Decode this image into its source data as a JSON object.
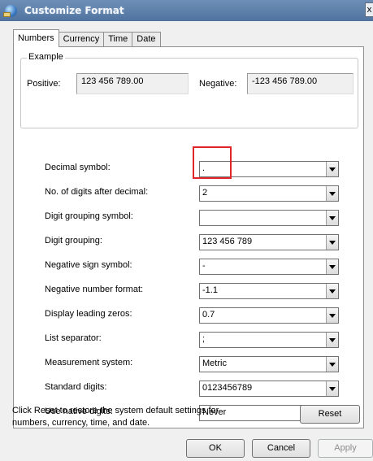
{
  "window": {
    "title": "Customize Format",
    "close_glyph": "x"
  },
  "tabs": [
    {
      "label": "Numbers",
      "active": true
    },
    {
      "label": "Currency",
      "active": false
    },
    {
      "label": "Time",
      "active": false
    },
    {
      "label": "Date",
      "active": false
    }
  ],
  "example": {
    "legend": "Example",
    "positive_label": "Positive:",
    "positive_value": "123 456 789.00",
    "negative_label": "Negative:",
    "negative_value": "-123 456 789.00"
  },
  "settings": [
    {
      "label": "Decimal symbol:",
      "value": "."
    },
    {
      "label": "No. of digits after decimal:",
      "value": "2"
    },
    {
      "label": "Digit grouping symbol:",
      "value": ""
    },
    {
      "label": "Digit grouping:",
      "value": "123 456 789"
    },
    {
      "label": "Negative sign symbol:",
      "value": "-"
    },
    {
      "label": "Negative number format:",
      "value": "-1.1"
    },
    {
      "label": "Display leading zeros:",
      "value": "0.7"
    },
    {
      "label": "List separator:",
      "value": ";"
    },
    {
      "label": "Measurement system:",
      "value": "Metric"
    },
    {
      "label": "Standard digits:",
      "value": "0123456789"
    },
    {
      "label": "Use native digits:",
      "value": "Never"
    }
  ],
  "info_text": "Click Reset to restore the system default settings for numbers, currency, time, and date.",
  "buttons": {
    "reset": "Reset",
    "ok": "OK",
    "cancel": "Cancel",
    "apply": "Apply"
  },
  "colors": {
    "highlight": "#e0262b"
  }
}
